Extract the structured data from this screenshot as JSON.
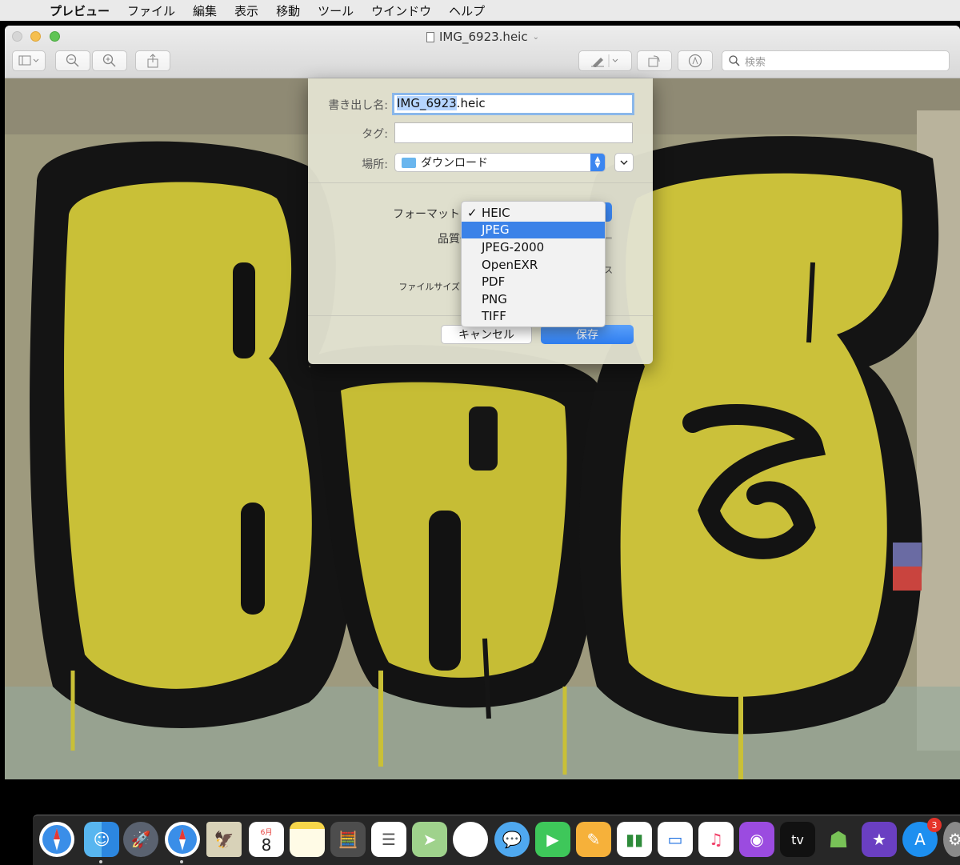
{
  "menubar": {
    "app": "プレビュー",
    "items": [
      "ファイル",
      "編集",
      "表示",
      "移動",
      "ツール",
      "ウインドウ",
      "ヘルプ"
    ]
  },
  "window": {
    "title": "IMG_6923.heic",
    "search_placeholder": "検索"
  },
  "sheet": {
    "export_label": "書き出し名:",
    "export_name_selected": "IMG_6923",
    "export_name_ext": ".heic",
    "tag_label": "タグ:",
    "location_label": "場所:",
    "location_value": "ダウンロード",
    "format_label": "フォーマット",
    "quality_label": "品質",
    "filesize_label": "ファイルサイズ",
    "cancel_label": "キャンセル",
    "save_label": "保存"
  },
  "format_menu": {
    "checked": "✓",
    "options": [
      "HEIC",
      "JPEG",
      "JPEG-2000",
      "OpenEXR",
      "PDF",
      "PNG",
      "TIFF"
    ],
    "checked_option": "HEIC",
    "highlighted_option": "JPEG"
  },
  "dock": {
    "calendar_month": "6月",
    "calendar_day": "8",
    "appstore_badge": "3",
    "tv_label": "tv",
    "icons": [
      "safari-download-icon",
      "finder-icon",
      "launchpad-icon",
      "safari-icon",
      "mail-stamp-icon",
      "calendar-icon",
      "notes-icon",
      "calculator-icon",
      "reminders-icon",
      "maps-icon",
      "photos-icon",
      "messages-icon",
      "facetime-icon",
      "pages-icon",
      "numbers-icon",
      "keynote-icon",
      "music-icon",
      "podcasts-icon",
      "appletv-icon",
      "android-icon",
      "imovie-icon",
      "appstore-icon",
      "system-preferences-icon"
    ]
  }
}
